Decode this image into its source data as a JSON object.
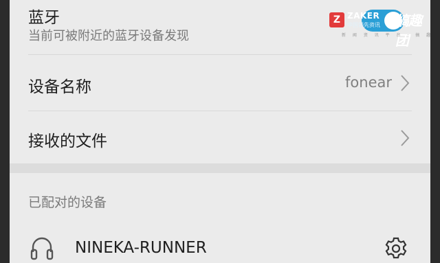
{
  "bluetooth": {
    "title": "蓝牙",
    "subtitle": "当前可被附近的蓝牙设备发现",
    "enabled": true
  },
  "device_name": {
    "label": "设备名称",
    "value": "fonear"
  },
  "received_files": {
    "label": "接收的文件"
  },
  "paired_section": {
    "header": "已配对的设备",
    "devices": [
      {
        "name": "NINEKA-RUNNER",
        "icon": "headset-icon"
      }
    ]
  },
  "watermark": {
    "logo": "Z",
    "brand_text": "ZAKER",
    "brand_sub": "中国领先资讯",
    "cross": "×",
    "partner": "搞趣团",
    "tagline": "新 闻 资 讯 平 台 · 搞 趣 团"
  },
  "colors": {
    "accent": "#2a9fd6",
    "background": "#ebebeb",
    "text_primary": "#1f1f1f",
    "text_secondary": "#7a7a7a"
  }
}
